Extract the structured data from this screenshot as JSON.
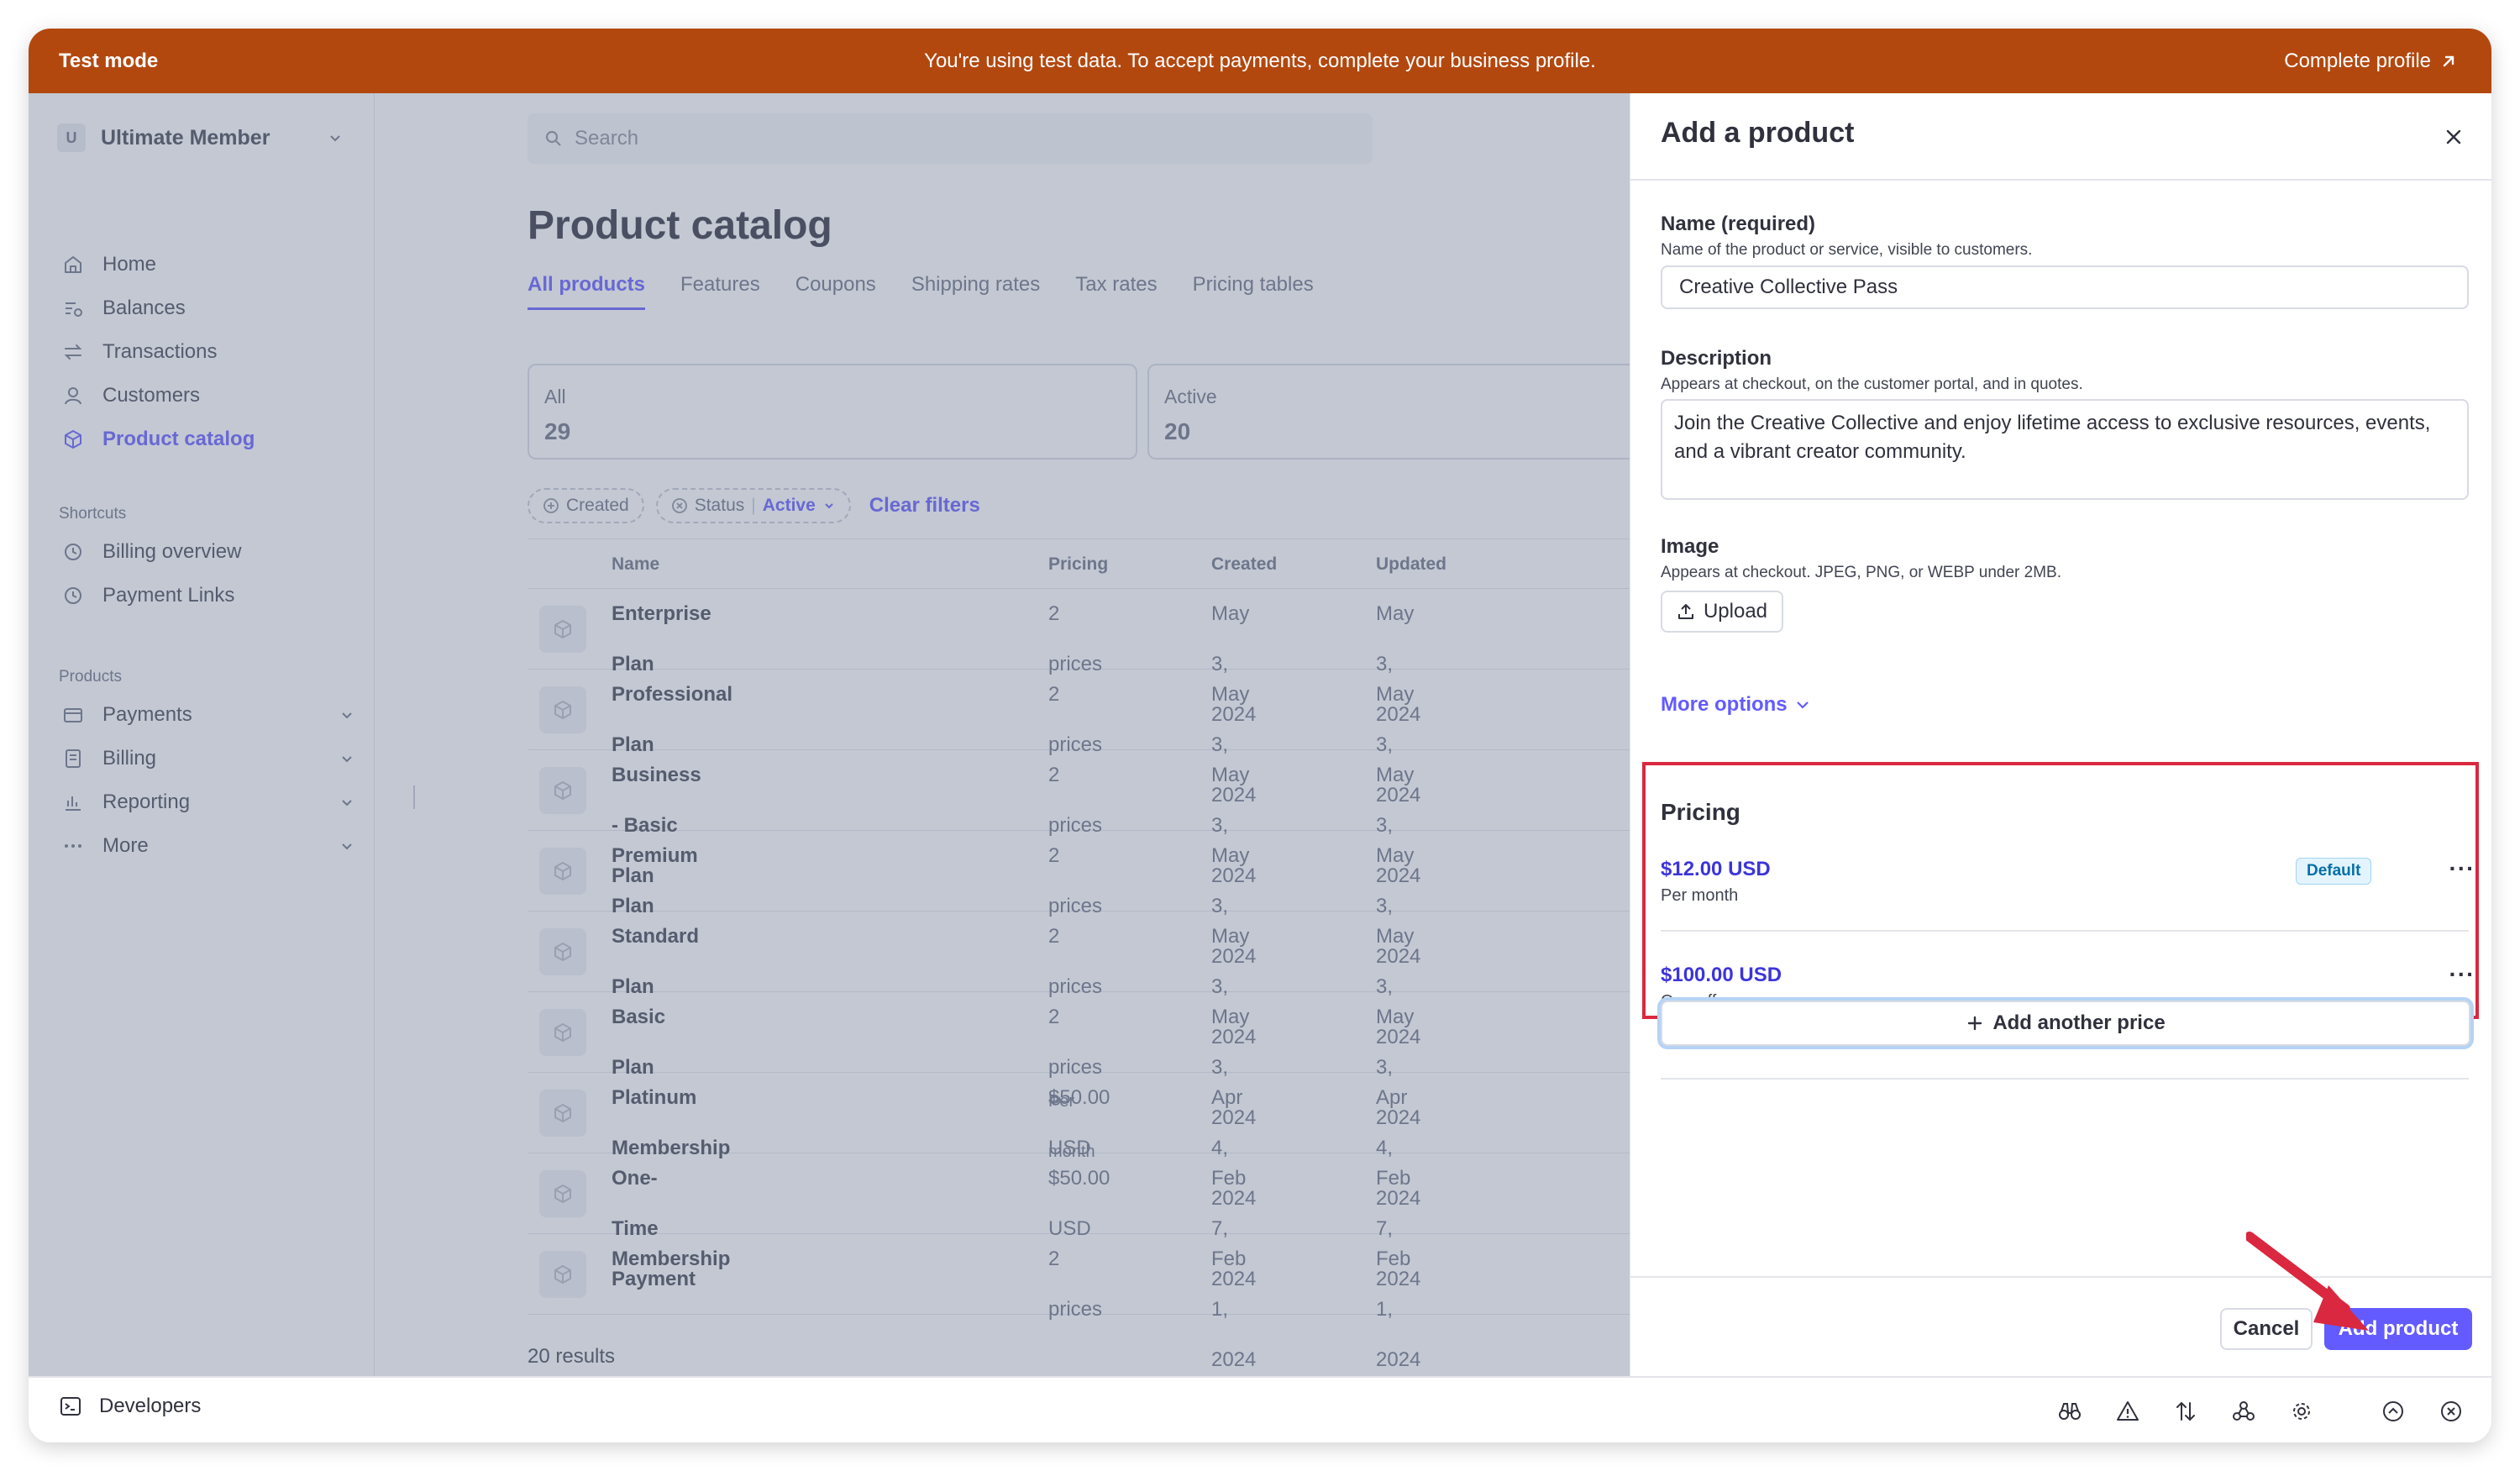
{
  "banner": {
    "mode": "Test mode",
    "message": "You're using test data. To accept payments, complete your business profile.",
    "cta": "Complete profile"
  },
  "sidebar": {
    "account_initial": "U",
    "account_name": "Ultimate Member",
    "main_items": [
      {
        "label": "Home",
        "icon": "home-icon"
      },
      {
        "label": "Balances",
        "icon": "balances-icon"
      },
      {
        "label": "Transactions",
        "icon": "transactions-icon"
      },
      {
        "label": "Customers",
        "icon": "customers-icon"
      },
      {
        "label": "Product catalog",
        "icon": "product-catalog-icon",
        "active": true
      }
    ],
    "shortcuts_heading": "Shortcuts",
    "shortcuts": [
      {
        "label": "Billing overview",
        "icon": "clock-icon"
      },
      {
        "label": "Payment Links",
        "icon": "clock-icon"
      }
    ],
    "products_heading": "Products",
    "products": [
      {
        "label": "Payments",
        "icon": "payments-icon"
      },
      {
        "label": "Billing",
        "icon": "billing-icon"
      },
      {
        "label": "Reporting",
        "icon": "reporting-icon"
      },
      {
        "label": "More",
        "icon": "more-icon"
      }
    ]
  },
  "main": {
    "search_placeholder": "Search",
    "title": "Product catalog",
    "tabs": [
      "All products",
      "Features",
      "Coupons",
      "Shipping rates",
      "Tax rates",
      "Pricing tables"
    ],
    "stats": [
      {
        "label": "All",
        "value": "29"
      },
      {
        "label": "Active",
        "value": "20"
      }
    ],
    "filters": {
      "created": "Created",
      "status": "Status",
      "status_value": "Active",
      "clear": "Clear filters"
    },
    "columns": [
      "Name",
      "Pricing",
      "Created",
      "Updated"
    ],
    "rows": [
      {
        "name": "Enterprise Plan",
        "pricing": "2 prices",
        "pricing_sub": "",
        "created": "May 3, 2024",
        "updated": "May 3, 2024"
      },
      {
        "name": "Professional Plan",
        "pricing": "2 prices",
        "pricing_sub": "",
        "created": "May 3, 2024",
        "updated": "May 3, 2024"
      },
      {
        "name": "Business - Basic Plan",
        "pricing": "2 prices",
        "pricing_sub": "",
        "created": "May 3, 2024",
        "updated": "May 3, 2024"
      },
      {
        "name": "Premium Plan",
        "pricing": "2 prices",
        "pricing_sub": "",
        "created": "May 3, 2024",
        "updated": "May 3, 2024"
      },
      {
        "name": "Standard Plan",
        "pricing": "2 prices",
        "pricing_sub": "",
        "created": "May 3, 2024",
        "updated": "May 3, 2024"
      },
      {
        "name": "Basic Plan",
        "pricing": "2 prices",
        "pricing_sub": "",
        "created": "May 3, 2024",
        "updated": "May 3, 2024"
      },
      {
        "name": "Platinum Membership",
        "pricing": "$50.00 USD",
        "pricing_sub": "Per month",
        "created": "Apr 4, 2024",
        "updated": "Apr 4, 2024"
      },
      {
        "name": "One-Time Payment",
        "pricing": "$50.00 USD",
        "pricing_sub": "",
        "created": "Feb 7, 2024",
        "updated": "Feb 7, 2024"
      },
      {
        "name": "Membership",
        "pricing": "2 prices",
        "pricing_sub": "",
        "created": "Feb 1, 2024",
        "updated": "Feb 1, 2024"
      }
    ],
    "results": "20 results"
  },
  "drawer": {
    "title": "Add a product",
    "name_label": "Name (required)",
    "name_help": "Name of the product or service, visible to customers.",
    "name_value": "Creative Collective Pass",
    "description_label": "Description",
    "description_help": "Appears at checkout, on the customer portal, and in quotes.",
    "description_value": "Join the Creative Collective and enjoy lifetime access to exclusive resources, events, and a vibrant creator community.",
    "image_label": "Image",
    "image_help": "Appears at checkout. JPEG, PNG, or WEBP under 2MB.",
    "upload_label": "Upload",
    "more_options": "More options",
    "pricing_title": "Pricing",
    "prices": [
      {
        "amount": "$12.00 USD",
        "interval": "Per month",
        "badge": "Default"
      },
      {
        "amount": "$100.00 USD",
        "interval": "One-off",
        "badge": ""
      }
    ],
    "add_price": "Add another price",
    "cancel": "Cancel",
    "submit": "Add product"
  },
  "devbar": {
    "label": "Developers"
  },
  "colors": {
    "banner": "#b3480f",
    "accent": "#635bff",
    "highlight": "#d9283f"
  }
}
